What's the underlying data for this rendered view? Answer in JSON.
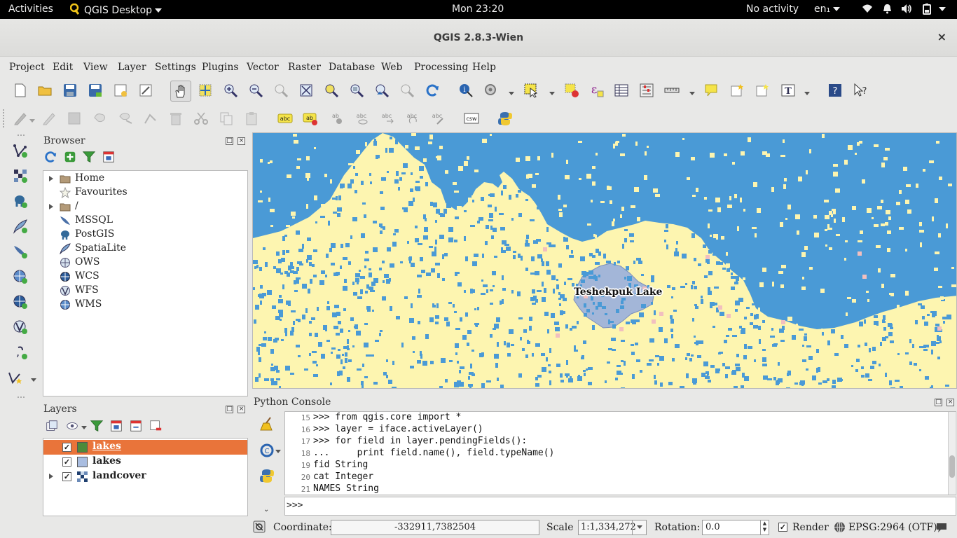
{
  "topbar": {
    "activities": "Activities",
    "app_name": "QGIS Desktop",
    "clock": "Mon 23:20",
    "no_activity": "No activity",
    "keyboard": "en₁"
  },
  "window": {
    "title": "QGIS 2.8.3-Wien",
    "close": "×"
  },
  "menu": {
    "items": [
      "Project",
      "Edit",
      "View",
      "Layer",
      "Settings",
      "Plugins",
      "Vector",
      "Raster",
      "Database",
      "Web",
      "Processing",
      "Help"
    ]
  },
  "toolbar2": {
    "csw_label": "csw",
    "abc": "abc"
  },
  "browser": {
    "title": "Browser",
    "items": [
      {
        "label": "Home",
        "icon": "folder-icon",
        "expandable": true
      },
      {
        "label": "Favourites",
        "icon": "star-icon",
        "expandable": false
      },
      {
        "label": "/",
        "icon": "folder-icon",
        "expandable": true
      },
      {
        "label": "MSSQL",
        "icon": "mssql-icon",
        "expandable": false
      },
      {
        "label": "PostGIS",
        "icon": "postgis-elephant-icon",
        "expandable": false
      },
      {
        "label": "SpatiaLite",
        "icon": "spatialite-feather-icon",
        "expandable": false
      },
      {
        "label": "OWS",
        "icon": "ows-globe-icon",
        "expandable": false
      },
      {
        "label": "WCS",
        "icon": "wcs-globe-icon",
        "expandable": false
      },
      {
        "label": "WFS",
        "icon": "wfs-globe-icon",
        "expandable": false
      },
      {
        "label": "WMS",
        "icon": "wms-globe-icon",
        "expandable": false
      }
    ]
  },
  "layers": {
    "title": "Layers",
    "items": [
      {
        "label": "lakes",
        "checked": true,
        "selected": true,
        "color": "#4e8a3a"
      },
      {
        "label": "lakes",
        "checked": true,
        "selected": false,
        "color": "#a9bde0"
      },
      {
        "label": "landcover",
        "checked": true,
        "selected": false,
        "color": "#1f4f8f"
      }
    ]
  },
  "map": {
    "label": "Teshekpuk Lake",
    "colors": {
      "water": "#4a9ad6",
      "land": "#fdf5b0",
      "lake": "#a3b6d8",
      "pink": "#f2bfbf"
    }
  },
  "console": {
    "title": "Python Console",
    "lines": [
      {
        "n": "15",
        "text": ">>> from qgis.core import *"
      },
      {
        "n": "16",
        "text": ">>> layer = iface.activeLayer()"
      },
      {
        "n": "17",
        "text": ">>> for field in layer.pendingFields():"
      },
      {
        "n": "18",
        "text": "...     print field.name(), field.typeName()"
      },
      {
        "n": "19",
        "text": "fid String"
      },
      {
        "n": "20",
        "text": "cat Integer"
      },
      {
        "n": "21",
        "text": "NAMES String"
      }
    ],
    "prompt": ">>>"
  },
  "status": {
    "coordinate_label": "Coordinate:",
    "coordinate": "-332911,7382504",
    "scale_label": "Scale",
    "scale": "1:1,334,272",
    "rotation_label": "Rotation:",
    "rotation": "0.0",
    "render_label": "Render",
    "crs": "EPSG:2964 (OTF)"
  }
}
